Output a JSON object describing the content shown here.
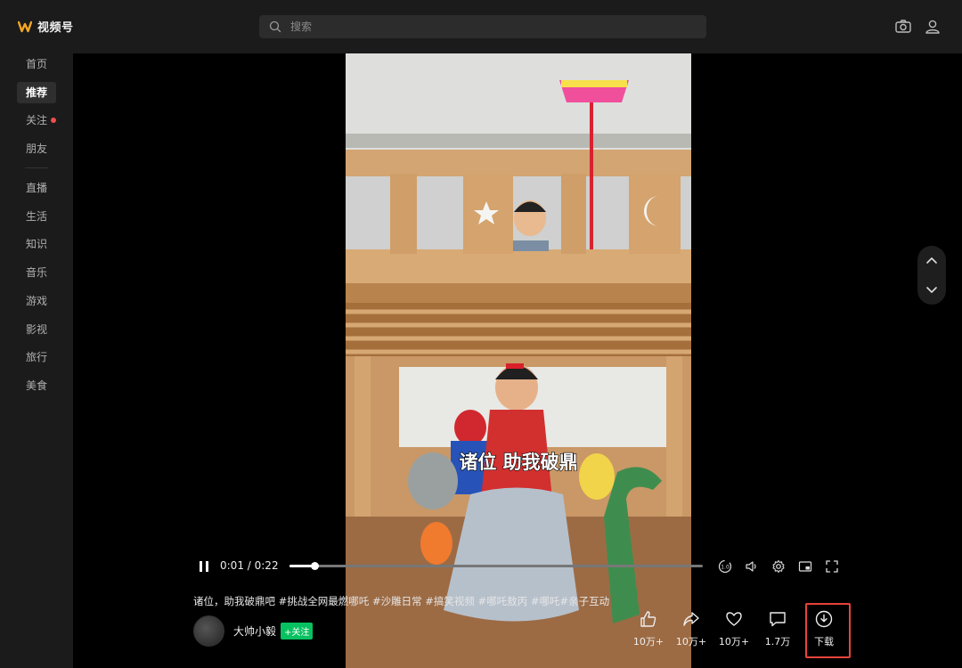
{
  "app": {
    "logo_text": "视频号"
  },
  "search": {
    "placeholder": "搜索"
  },
  "sidebar": {
    "items": [
      {
        "label": "首页"
      },
      {
        "label": "推荐",
        "active": true
      },
      {
        "label": "关注",
        "badge_dot": true
      },
      {
        "label": "朋友"
      },
      {
        "label": "直播"
      },
      {
        "label": "生活"
      },
      {
        "label": "知识"
      },
      {
        "label": "音乐"
      },
      {
        "label": "游戏"
      },
      {
        "label": "影视"
      },
      {
        "label": "旅行"
      },
      {
        "label": "美食"
      }
    ]
  },
  "player": {
    "current_time": "0:01",
    "duration": "0:22",
    "time_separator": " / ",
    "progress": 0.06,
    "subtitle": "诸位 助我破鼎",
    "speed_label": "1.0"
  },
  "post": {
    "caption": "诸位，助我破鼎吧 #挑战全网最燃哪吒 #沙雕日常 #搞笑视频 #哪吒敖丙 #哪吒#亲子互动",
    "author_name": "大帅小毅",
    "follow_label": "+关注"
  },
  "actions": {
    "like_count": "10万+",
    "share_count": "10万+",
    "heart_count": "10万+",
    "comment_count": "1.7万",
    "download_label": "下载"
  },
  "colors": {
    "accent_green": "#07c160",
    "badge_red": "#f24d4d",
    "highlight_border": "#e8433b"
  }
}
